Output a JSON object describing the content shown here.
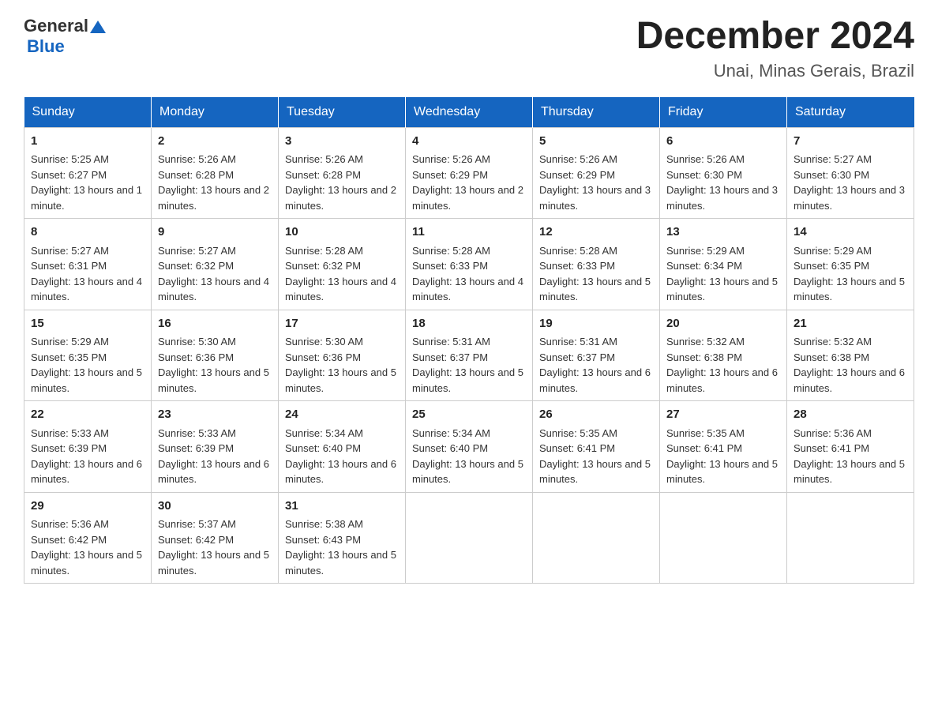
{
  "header": {
    "logo_general": "General",
    "logo_blue": "Blue",
    "month_year": "December 2024",
    "location": "Unai, Minas Gerais, Brazil"
  },
  "days_of_week": [
    "Sunday",
    "Monday",
    "Tuesday",
    "Wednesday",
    "Thursday",
    "Friday",
    "Saturday"
  ],
  "weeks": [
    [
      {
        "day": "1",
        "sunrise": "5:25 AM",
        "sunset": "6:27 PM",
        "daylight": "13 hours and 1 minute."
      },
      {
        "day": "2",
        "sunrise": "5:26 AM",
        "sunset": "6:28 PM",
        "daylight": "13 hours and 2 minutes."
      },
      {
        "day": "3",
        "sunrise": "5:26 AM",
        "sunset": "6:28 PM",
        "daylight": "13 hours and 2 minutes."
      },
      {
        "day": "4",
        "sunrise": "5:26 AM",
        "sunset": "6:29 PM",
        "daylight": "13 hours and 2 minutes."
      },
      {
        "day": "5",
        "sunrise": "5:26 AM",
        "sunset": "6:29 PM",
        "daylight": "13 hours and 3 minutes."
      },
      {
        "day": "6",
        "sunrise": "5:26 AM",
        "sunset": "6:30 PM",
        "daylight": "13 hours and 3 minutes."
      },
      {
        "day": "7",
        "sunrise": "5:27 AM",
        "sunset": "6:30 PM",
        "daylight": "13 hours and 3 minutes."
      }
    ],
    [
      {
        "day": "8",
        "sunrise": "5:27 AM",
        "sunset": "6:31 PM",
        "daylight": "13 hours and 4 minutes."
      },
      {
        "day": "9",
        "sunrise": "5:27 AM",
        "sunset": "6:32 PM",
        "daylight": "13 hours and 4 minutes."
      },
      {
        "day": "10",
        "sunrise": "5:28 AM",
        "sunset": "6:32 PM",
        "daylight": "13 hours and 4 minutes."
      },
      {
        "day": "11",
        "sunrise": "5:28 AM",
        "sunset": "6:33 PM",
        "daylight": "13 hours and 4 minutes."
      },
      {
        "day": "12",
        "sunrise": "5:28 AM",
        "sunset": "6:33 PM",
        "daylight": "13 hours and 5 minutes."
      },
      {
        "day": "13",
        "sunrise": "5:29 AM",
        "sunset": "6:34 PM",
        "daylight": "13 hours and 5 minutes."
      },
      {
        "day": "14",
        "sunrise": "5:29 AM",
        "sunset": "6:35 PM",
        "daylight": "13 hours and 5 minutes."
      }
    ],
    [
      {
        "day": "15",
        "sunrise": "5:29 AM",
        "sunset": "6:35 PM",
        "daylight": "13 hours and 5 minutes."
      },
      {
        "day": "16",
        "sunrise": "5:30 AM",
        "sunset": "6:36 PM",
        "daylight": "13 hours and 5 minutes."
      },
      {
        "day": "17",
        "sunrise": "5:30 AM",
        "sunset": "6:36 PM",
        "daylight": "13 hours and 5 minutes."
      },
      {
        "day": "18",
        "sunrise": "5:31 AM",
        "sunset": "6:37 PM",
        "daylight": "13 hours and 5 minutes."
      },
      {
        "day": "19",
        "sunrise": "5:31 AM",
        "sunset": "6:37 PM",
        "daylight": "13 hours and 6 minutes."
      },
      {
        "day": "20",
        "sunrise": "5:32 AM",
        "sunset": "6:38 PM",
        "daylight": "13 hours and 6 minutes."
      },
      {
        "day": "21",
        "sunrise": "5:32 AM",
        "sunset": "6:38 PM",
        "daylight": "13 hours and 6 minutes."
      }
    ],
    [
      {
        "day": "22",
        "sunrise": "5:33 AM",
        "sunset": "6:39 PM",
        "daylight": "13 hours and 6 minutes."
      },
      {
        "day": "23",
        "sunrise": "5:33 AM",
        "sunset": "6:39 PM",
        "daylight": "13 hours and 6 minutes."
      },
      {
        "day": "24",
        "sunrise": "5:34 AM",
        "sunset": "6:40 PM",
        "daylight": "13 hours and 6 minutes."
      },
      {
        "day": "25",
        "sunrise": "5:34 AM",
        "sunset": "6:40 PM",
        "daylight": "13 hours and 5 minutes."
      },
      {
        "day": "26",
        "sunrise": "5:35 AM",
        "sunset": "6:41 PM",
        "daylight": "13 hours and 5 minutes."
      },
      {
        "day": "27",
        "sunrise": "5:35 AM",
        "sunset": "6:41 PM",
        "daylight": "13 hours and 5 minutes."
      },
      {
        "day": "28",
        "sunrise": "5:36 AM",
        "sunset": "6:41 PM",
        "daylight": "13 hours and 5 minutes."
      }
    ],
    [
      {
        "day": "29",
        "sunrise": "5:36 AM",
        "sunset": "6:42 PM",
        "daylight": "13 hours and 5 minutes."
      },
      {
        "day": "30",
        "sunrise": "5:37 AM",
        "sunset": "6:42 PM",
        "daylight": "13 hours and 5 minutes."
      },
      {
        "day": "31",
        "sunrise": "5:38 AM",
        "sunset": "6:43 PM",
        "daylight": "13 hours and 5 minutes."
      },
      {
        "day": "",
        "sunrise": "",
        "sunset": "",
        "daylight": ""
      },
      {
        "day": "",
        "sunrise": "",
        "sunset": "",
        "daylight": ""
      },
      {
        "day": "",
        "sunrise": "",
        "sunset": "",
        "daylight": ""
      },
      {
        "day": "",
        "sunrise": "",
        "sunset": "",
        "daylight": ""
      }
    ]
  ],
  "labels": {
    "sunrise_prefix": "Sunrise: ",
    "sunset_prefix": "Sunset: ",
    "daylight_prefix": "Daylight: "
  }
}
